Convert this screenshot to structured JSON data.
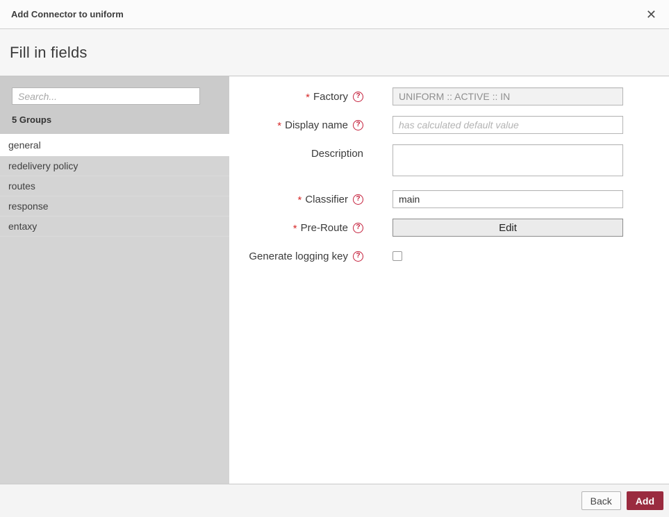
{
  "dialog": {
    "title": "Add Connector to uniform",
    "subtitle": "Fill in fields"
  },
  "icons": {
    "close": "✕",
    "required": "*",
    "help": "?"
  },
  "sidebar": {
    "search_placeholder": "Search...",
    "groups_count_label": "5 Groups",
    "items": [
      {
        "label": "general",
        "selected": true
      },
      {
        "label": "redelivery policy",
        "selected": false
      },
      {
        "label": "routes",
        "selected": false
      },
      {
        "label": "response",
        "selected": false
      },
      {
        "label": "entaxy",
        "selected": false
      }
    ]
  },
  "form": {
    "fields": [
      {
        "label": "Factory",
        "required": true,
        "help": true,
        "type": "text",
        "value": "UNIFORM :: ACTIVE :: IN",
        "disabled": true
      },
      {
        "label": "Display name",
        "required": true,
        "help": true,
        "type": "text",
        "value": "",
        "placeholder": "has calculated default value"
      },
      {
        "label": "Description",
        "required": false,
        "help": false,
        "type": "textarea",
        "value": ""
      },
      {
        "label": "Classifier",
        "required": true,
        "help": true,
        "type": "text",
        "value": "main"
      },
      {
        "label": "Pre-Route",
        "required": true,
        "help": true,
        "type": "button",
        "button_label": "Edit"
      },
      {
        "label": "Generate logging key",
        "required": false,
        "help": true,
        "type": "checkbox",
        "checked": false
      }
    ]
  },
  "footer": {
    "back_label": "Back",
    "add_label": "Add"
  },
  "colors": {
    "accent_red": "#c41e3a",
    "asterisk_red": "#d62a2a",
    "add_button_bg": "#9a2b3f",
    "sidebar_bg": "#d4d4d4",
    "sidebar_top_bg": "#cbcbcb",
    "selected_item_bg": "#ffffff"
  }
}
